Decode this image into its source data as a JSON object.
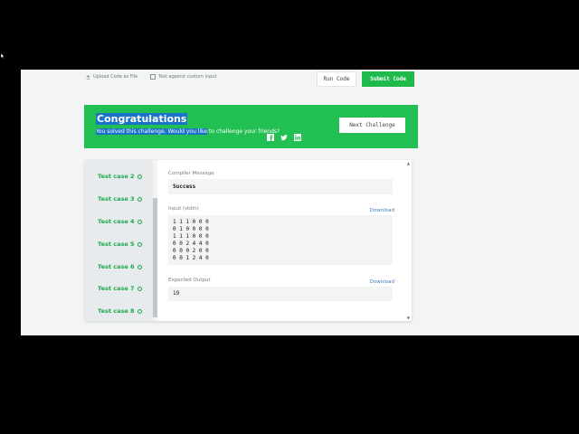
{
  "toolbar": {
    "upload_label": "Upload Code as File",
    "custom_input_label": "Test against custom input",
    "run_label": "Run Code",
    "submit_label": "Submit Code"
  },
  "banner": {
    "title": "Congratulations",
    "message_highlighted": "You solved this challenge. Would you like",
    "message_rest": " to challenge your friends?",
    "next_label": "Next Challenge"
  },
  "tests": [
    {
      "label": "Test case 2"
    },
    {
      "label": "Test case 3"
    },
    {
      "label": "Test case 4"
    },
    {
      "label": "Test case 5"
    },
    {
      "label": "Test case 6"
    },
    {
      "label": "Test case 7"
    },
    {
      "label": "Test case 8"
    }
  ],
  "result": {
    "compiler_label": "Compiler Message",
    "compiler_message": "Success",
    "input_label": "Input (stdin)",
    "input_lines": [
      "1 1 1 0 0 0",
      "0 1 0 0 0 0",
      "1 1 1 0 0 0",
      "0 0 2 4 4 0",
      "0 0 0 2 0 0",
      "0 0 1 2 4 0"
    ],
    "expected_label": "Expected Output",
    "expected_value": "19",
    "download_label": "Download"
  },
  "colors": {
    "accent_green": "#1fba4b",
    "selection_blue": "#1a73c9",
    "link_blue": "#3f7bbf"
  },
  "icons": [
    "upload-icon",
    "checkbox-icon",
    "facebook-icon",
    "twitter-icon",
    "linkedin-icon",
    "check-circle-icon"
  ]
}
